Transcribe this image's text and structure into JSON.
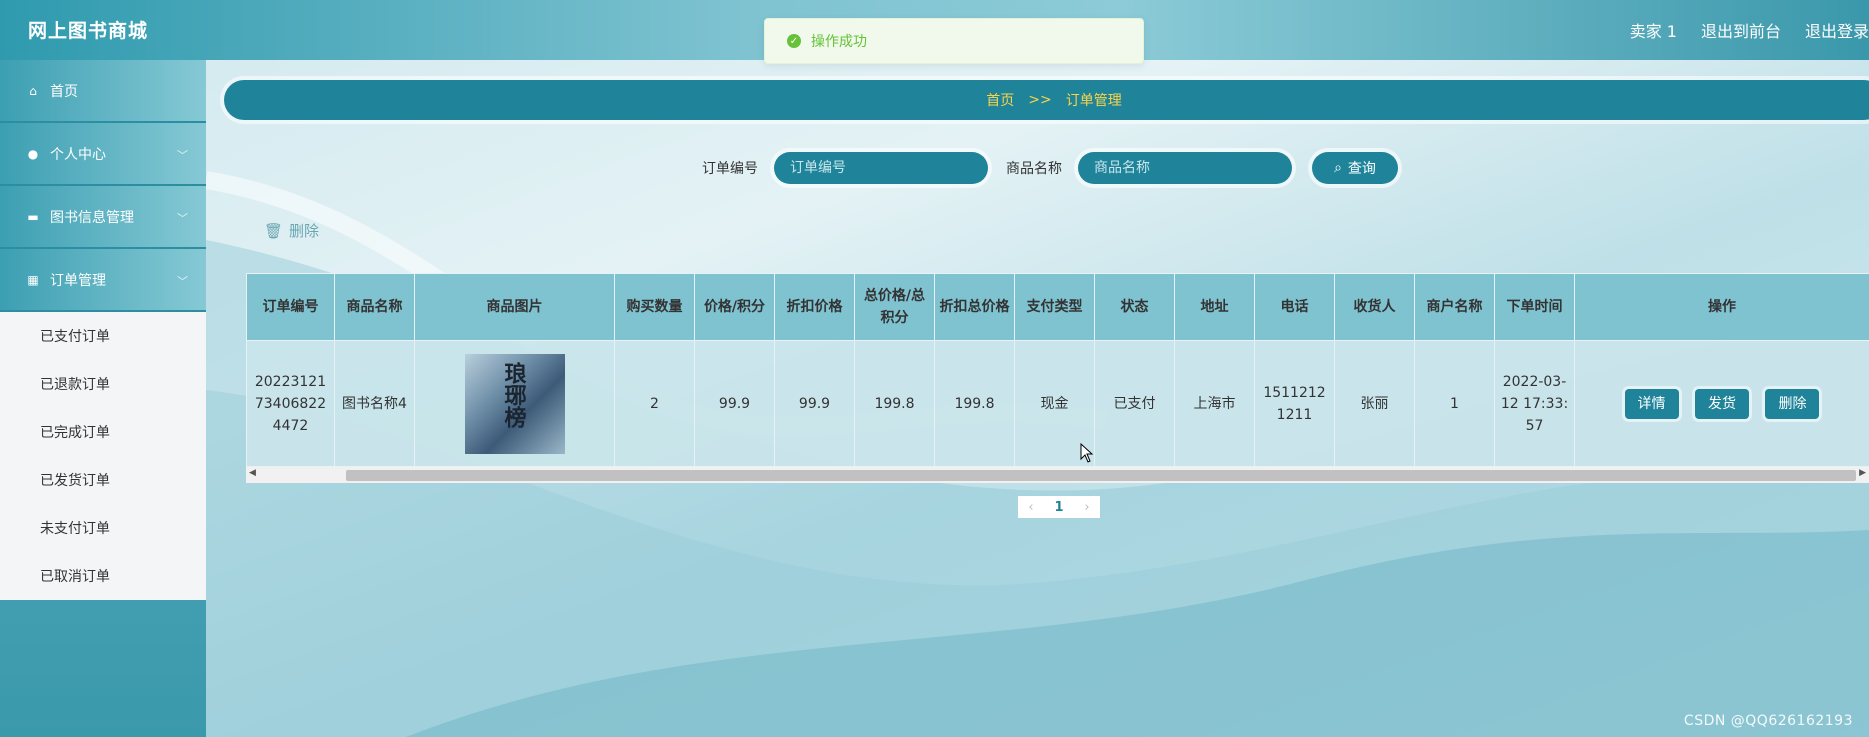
{
  "header": {
    "brand": "网上图书商城",
    "user": "卖家 1",
    "to_front": "退出到前台",
    "logout": "退出登录"
  },
  "toast": {
    "message": "操作成功",
    "icon": "check-circle-icon",
    "color": "#67c23a"
  },
  "sidebar": {
    "items": [
      {
        "label": "首页",
        "icon": "home-icon"
      },
      {
        "label": "个人中心",
        "icon": "user-icon"
      },
      {
        "label": "图书信息管理",
        "icon": "briefcase-icon"
      },
      {
        "label": "订单管理",
        "icon": "grid-icon"
      }
    ],
    "submenu": [
      "已支付订单",
      "已退款订单",
      "已完成订单",
      "已发货订单",
      "未支付订单",
      "已取消订单"
    ]
  },
  "breadcrumb": {
    "home": "首页",
    "sep": ">>",
    "current": "订单管理"
  },
  "search": {
    "order_label": "订单编号",
    "order_placeholder": "订单编号",
    "name_label": "商品名称",
    "name_placeholder": "商品名称",
    "button": "查询"
  },
  "bulk_delete": "删除",
  "table": {
    "headers": [
      "订单编号",
      "商品名称",
      "商品图片",
      "购买数量",
      "价格/积分",
      "折扣价格",
      "总价格/总积分",
      "折扣总价格",
      "支付类型",
      "状态",
      "地址",
      "电话",
      "收货人",
      "商户名称",
      "下单时间",
      "操作"
    ],
    "rows": [
      {
        "order_no": "20223121734068224472",
        "name": "图书名称4",
        "image_text": "琅琊榜",
        "qty": "2",
        "price": "99.9",
        "discount_price": "99.9",
        "total": "199.8",
        "discount_total": "199.8",
        "pay_type": "现金",
        "status": "已支付",
        "address": "上海市",
        "phone": "15112121211",
        "receiver": "张丽",
        "merchant": "1",
        "time": "2022-03-12 17:33:57",
        "actions": [
          "详情",
          "发货",
          "删除"
        ]
      }
    ]
  },
  "pagination": {
    "current": "1"
  },
  "watermark": "CSDN @QQ626162193",
  "colors": {
    "accent": "#1f8499",
    "breadcrumb_text": "#f8d44b"
  }
}
